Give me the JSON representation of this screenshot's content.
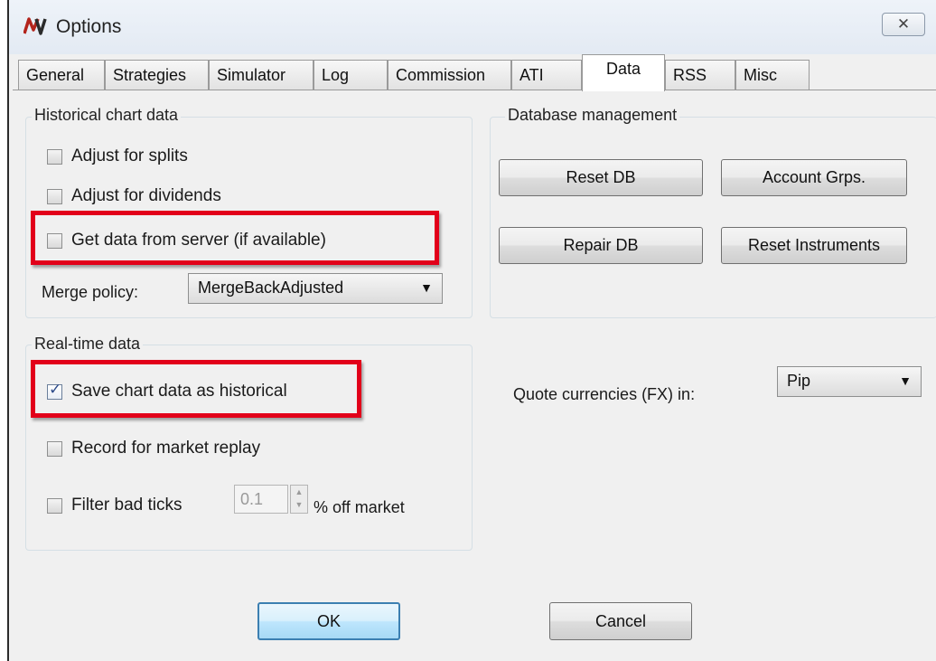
{
  "window": {
    "title": "Options",
    "close_glyph": "✕",
    "logo_icon": "ninjatrader-logo-icon"
  },
  "tabs": [
    {
      "label": "General",
      "active": false
    },
    {
      "label": "Strategies",
      "active": false
    },
    {
      "label": "Simulator",
      "active": false
    },
    {
      "label": "Log",
      "active": false
    },
    {
      "label": "Commission",
      "active": false
    },
    {
      "label": "ATI",
      "active": false
    },
    {
      "label": "Data",
      "active": true
    },
    {
      "label": "RSS",
      "active": false
    },
    {
      "label": "Misc",
      "active": false
    }
  ],
  "historical": {
    "title": "Historical chart data",
    "adjust_splits": {
      "label": "Adjust for splits",
      "checked": false
    },
    "adjust_dividends": {
      "label": "Adjust for dividends",
      "checked": false
    },
    "get_from_server": {
      "label": "Get data from server (if available)",
      "checked": false
    },
    "merge_policy_label": "Merge policy:",
    "merge_policy_value": "MergeBackAdjusted"
  },
  "database": {
    "title": "Database management",
    "reset_db": "Reset DB",
    "account_grps": "Account Grps.",
    "repair_db": "Repair DB",
    "reset_instruments": "Reset Instruments"
  },
  "realtime": {
    "title": "Real-time data",
    "save_chart": {
      "label": "Save chart data as historical",
      "checked": true
    },
    "record_replay": {
      "label": "Record for market replay",
      "checked": false
    },
    "filter_bad_ticks": {
      "label": "Filter bad ticks",
      "checked": false
    },
    "filter_value": "0.1",
    "filter_suffix": "% off market"
  },
  "quote": {
    "label": "Quote currencies (FX) in:",
    "value": "Pip"
  },
  "footer": {
    "ok": "OK",
    "cancel": "Cancel"
  },
  "colors": {
    "highlight": "#e2001a",
    "accent": "#3c7fb1"
  }
}
